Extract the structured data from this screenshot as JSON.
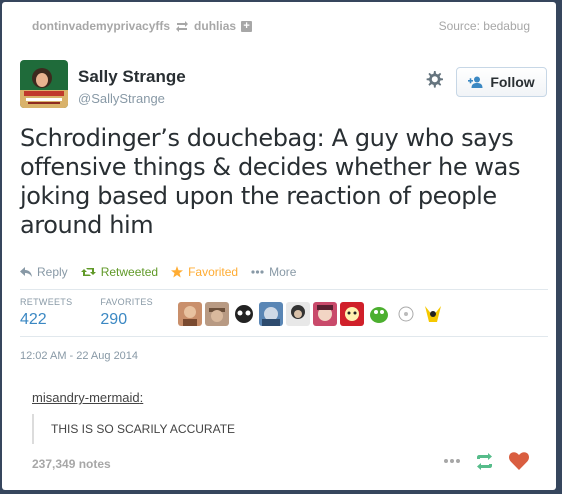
{
  "header": {
    "poster": "dontinvademyprivacyffs",
    "reblogged_from": "duhlias",
    "source_label": "Source:",
    "source": "bedabug"
  },
  "tweet": {
    "name": "Sally Strange",
    "handle": "@SallyStrange",
    "follow_label": "Follow",
    "text": "Schrodinger’s douchebag: A guy who says offensive things & decides whether he was joking based upon the reaction of people around him",
    "actions": {
      "reply": "Reply",
      "retweeted": "Retweeted",
      "favorited": "Favorited",
      "more": "More"
    },
    "stats": {
      "retweets_label": "RETWEETS",
      "retweets": "422",
      "favorites_label": "FAVORITES",
      "favorites": "290"
    },
    "timestamp": "12:02 AM - 22 Aug 2014"
  },
  "caption": {
    "user": "misandry-mermaid",
    "user_suffix": ":",
    "quote": "THIS IS SO SCARILY ACCURATE"
  },
  "notes": "237,349 notes",
  "colors": {
    "dashboard_bg": "#36465d",
    "link_blue": "#3b88c3",
    "retweet_green": "#609928",
    "favorite_orange": "#ffac33",
    "like_red": "#d95e40"
  }
}
